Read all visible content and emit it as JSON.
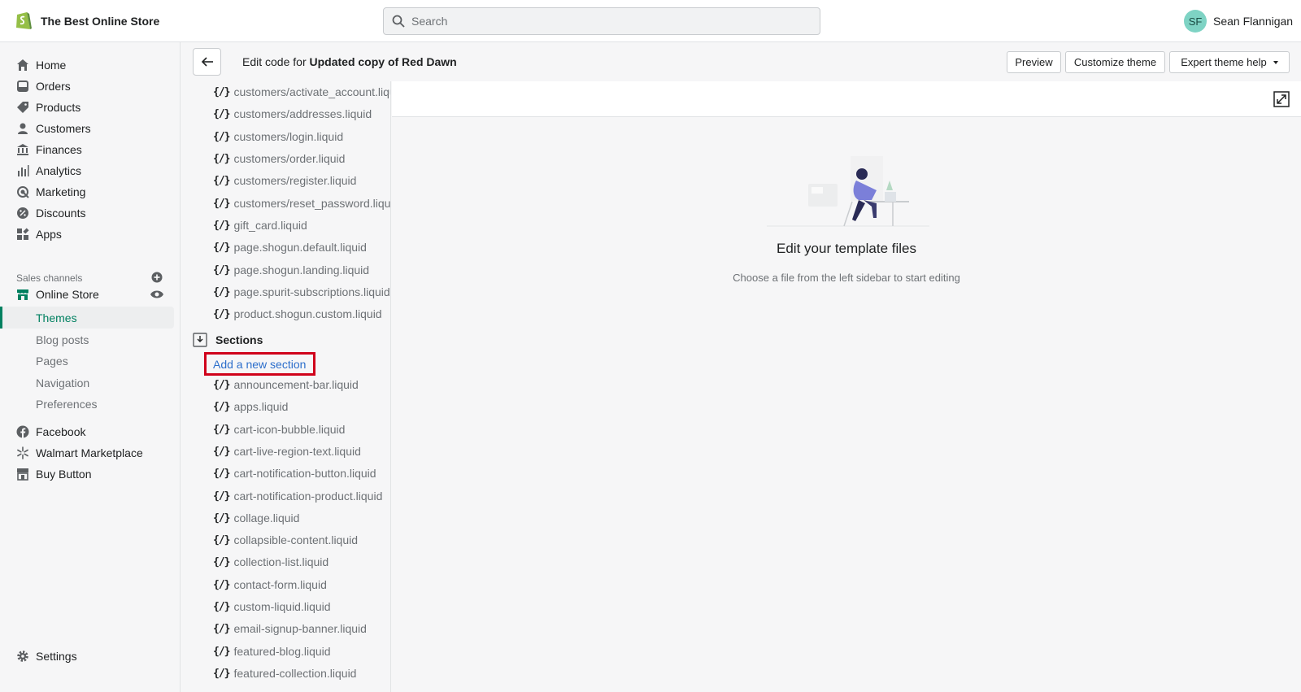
{
  "topbar": {
    "store_name": "The Best Online Store",
    "search_placeholder": "Search",
    "user_initials": "SF",
    "user_name": "Sean Flannigan"
  },
  "sidebar": {
    "items": [
      {
        "label": "Home",
        "icon": "home-icon"
      },
      {
        "label": "Orders",
        "icon": "orders-icon"
      },
      {
        "label": "Products",
        "icon": "tag-icon"
      },
      {
        "label": "Customers",
        "icon": "person-icon"
      },
      {
        "label": "Finances",
        "icon": "bank-icon"
      },
      {
        "label": "Analytics",
        "icon": "bar-chart-icon"
      },
      {
        "label": "Marketing",
        "icon": "target-icon"
      },
      {
        "label": "Discounts",
        "icon": "discount-icon"
      },
      {
        "label": "Apps",
        "icon": "apps-icon"
      }
    ],
    "sales_channels_title": "Sales channels",
    "online_store": "Online Store",
    "sub_items": [
      "Themes",
      "Blog posts",
      "Pages",
      "Navigation",
      "Preferences"
    ],
    "channels": [
      "Facebook",
      "Walmart Marketplace",
      "Buy Button"
    ],
    "settings": "Settings"
  },
  "header": {
    "title_prefix": "Edit code for ",
    "title_theme": "Updated copy of Red Dawn",
    "preview": "Preview",
    "customize": "Customize theme",
    "expert": "Expert theme help"
  },
  "filetree": {
    "file_icon": "{/}",
    "templates": [
      "customers/activate_account.liquid",
      "customers/addresses.liquid",
      "customers/login.liquid",
      "customers/order.liquid",
      "customers/register.liquid",
      "customers/reset_password.liquid",
      "gift_card.liquid",
      "page.shogun.default.liquid",
      "page.shogun.landing.liquid",
      "page.spurit-subscriptions.liquid",
      "product.shogun.custom.liquid"
    ],
    "sections_label": "Sections",
    "add_section": "Add a new section",
    "sections": [
      "announcement-bar.liquid",
      "apps.liquid",
      "cart-icon-bubble.liquid",
      "cart-live-region-text.liquid",
      "cart-notification-button.liquid",
      "cart-notification-product.liquid",
      "collage.liquid",
      "collapsible-content.liquid",
      "collection-list.liquid",
      "contact-form.liquid",
      "custom-liquid.liquid",
      "email-signup-banner.liquid",
      "featured-blog.liquid",
      "featured-collection.liquid"
    ]
  },
  "main": {
    "empty_title": "Edit your template files",
    "empty_subtitle": "Choose a file from the left sidebar to start editing"
  },
  "colors": {
    "accent": "#008060",
    "link": "#2c6ecb",
    "highlight_border": "#d0021b"
  }
}
